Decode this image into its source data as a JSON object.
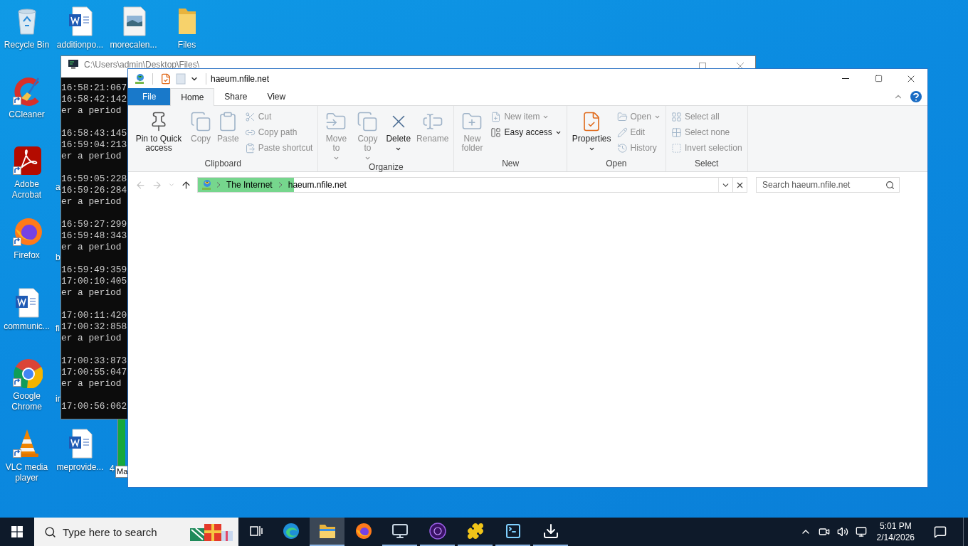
{
  "desktop": {
    "icons": [
      {
        "label": "Recycle Bin",
        "kind": "recycle-bin",
        "shortcut": false
      },
      {
        "label": "additionpo...",
        "kind": "word-doc",
        "shortcut": false
      },
      {
        "label": "morecalen...",
        "kind": "image-file",
        "shortcut": false
      },
      {
        "label": "Files",
        "kind": "folder",
        "shortcut": false
      },
      {
        "label": "CCleaner",
        "kind": "cleaner",
        "shortcut": true
      },
      {
        "label": "Adobe Acrobat",
        "kind": "pdf-app",
        "shortcut": true
      },
      {
        "label": "a",
        "kind": "clipped"
      },
      {
        "label": "Firefox",
        "kind": "fox-browser",
        "shortcut": true
      },
      {
        "label": "b",
        "kind": "clipped"
      },
      {
        "label": "communic...",
        "kind": "word-doc",
        "shortcut": false
      },
      {
        "label": "fi",
        "kind": "clipped"
      },
      {
        "label": "Google Chrome",
        "kind": "ring-browser",
        "shortcut": true
      },
      {
        "label": "ir",
        "kind": "clipped"
      },
      {
        "label": "VLC media player",
        "kind": "cone",
        "shortcut": true
      },
      {
        "label": "meprovide...",
        "kind": "word-doc",
        "shortcut": false
      },
      {
        "label": "4",
        "kind": "clipped"
      }
    ]
  },
  "console": {
    "title": "C:\\Users\\admin\\Desktop\\Files\\",
    "blocks": [
      [
        "16:58:21:067",
        "16:58:42:142",
        "er a period"
      ],
      [
        "16:58:43:145",
        "16:59:04:213",
        "er a period"
      ],
      [
        "16:59:05:228",
        "16:59:26:284",
        "er a period"
      ],
      [
        "16:59:27:299",
        "16:59:48:343",
        "er a period"
      ],
      [
        "16:59:49:359",
        "17:00:10:405",
        "er a period"
      ],
      [
        "17:00:11:420",
        "17:00:32:858",
        "er a period"
      ],
      [
        "17:00:33:873",
        "17:00:55:047",
        "er a period"
      ],
      [
        "17:00:56:062"
      ]
    ]
  },
  "small_window": {
    "label": "Ma"
  },
  "explorer": {
    "title": "haeum.nfile.net",
    "file_menu": {
      "label": "File"
    },
    "tabs": [
      {
        "label": "Home",
        "selected": true
      },
      {
        "label": "Share",
        "selected": false
      },
      {
        "label": "View",
        "selected": false
      }
    ],
    "groups": [
      {
        "label": "Clipboard",
        "buttons": [
          {
            "label": "Pin to Quick access",
            "kind": "large",
            "disabled": false,
            "dropdown": false
          },
          {
            "label": "Copy",
            "kind": "large",
            "disabled": true,
            "dropdown": false
          },
          {
            "label": "Paste",
            "kind": "large",
            "disabled": true,
            "dropdown": false
          },
          {
            "label": "Cut",
            "kind": "small",
            "disabled": true,
            "dropdown": false
          },
          {
            "label": "Copy path",
            "kind": "small",
            "disabled": true,
            "dropdown": false
          },
          {
            "label": "Paste shortcut",
            "kind": "small",
            "disabled": true,
            "dropdown": false
          }
        ]
      },
      {
        "label": "Organize",
        "buttons": [
          {
            "label": "Move to",
            "kind": "large",
            "disabled": true,
            "dropdown": true
          },
          {
            "label": "Copy to",
            "kind": "large",
            "disabled": true,
            "dropdown": true
          },
          {
            "label": "Delete",
            "kind": "large",
            "disabled": false,
            "dropdown": true
          },
          {
            "label": "Rename",
            "kind": "large",
            "disabled": true,
            "dropdown": false
          }
        ]
      },
      {
        "label": "New",
        "buttons": [
          {
            "label": "New folder",
            "kind": "large",
            "disabled": true,
            "dropdown": false
          },
          {
            "label": "New item",
            "kind": "small",
            "disabled": true,
            "dropdown": true
          },
          {
            "label": "Easy access",
            "kind": "small",
            "disabled": false,
            "dropdown": true
          }
        ]
      },
      {
        "label": "Open",
        "buttons": [
          {
            "label": "Properties",
            "kind": "large",
            "disabled": false,
            "dropdown": true
          },
          {
            "label": "Open",
            "kind": "small",
            "disabled": true,
            "dropdown": true
          },
          {
            "label": "Edit",
            "kind": "small",
            "disabled": true,
            "dropdown": false
          },
          {
            "label": "History",
            "kind": "small",
            "disabled": true,
            "dropdown": false
          }
        ]
      },
      {
        "label": "Select",
        "buttons": [
          {
            "label": "Select all",
            "kind": "small",
            "disabled": true,
            "dropdown": false
          },
          {
            "label": "Select none",
            "kind": "small",
            "disabled": true,
            "dropdown": false
          },
          {
            "label": "Invert selection",
            "kind": "small",
            "disabled": true,
            "dropdown": false
          }
        ]
      }
    ],
    "address": {
      "level": 0.18,
      "crumbs": [
        "The Internet",
        "haeum.nfile.net"
      ]
    },
    "search": {
      "placeholder": "Search haeum.nfile.net"
    }
  },
  "taskbar": {
    "search": {
      "placeholder": "Type here to search"
    },
    "apps": [
      {
        "running": false,
        "selected": false
      },
      {
        "running": true,
        "selected": true
      },
      {
        "running": false,
        "selected": false
      },
      {
        "running": true,
        "selected": false
      },
      {
        "running": true,
        "selected": false
      },
      {
        "running": true,
        "selected": false
      },
      {
        "running": true,
        "selected": false
      },
      {
        "running": true,
        "selected": false
      }
    ],
    "clock": {
      "time": "5:01 PM",
      "date": "2/14/2026"
    }
  }
}
